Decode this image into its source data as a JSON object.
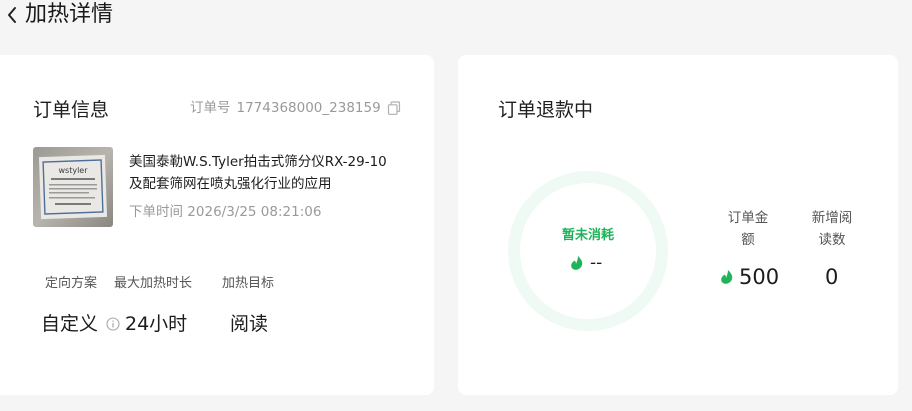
{
  "header": {
    "title": "加热详情"
  },
  "order_info": {
    "title": "订单信息",
    "order_no_label": "订单号",
    "order_no": "1774368000_238159",
    "product_title": "美国泰勒W.S.Tyler拍击式筛分仪RX-29-10及配套筛网在喷丸强化行业的应用",
    "order_time_label": "下单时间",
    "order_time": "2026/3/25 08:21:06",
    "thumb_text": "wstyler",
    "fields": [
      {
        "label": "定向方案",
        "value": "自定义"
      },
      {
        "label": "最大加热时长",
        "value": "24小时"
      },
      {
        "label": "加热目标",
        "value": "阅读"
      }
    ]
  },
  "refund": {
    "title": "订单退款中",
    "ring_label": "暂未消耗",
    "ring_value": "--",
    "stats": [
      {
        "label": "订单金额",
        "value": "500"
      },
      {
        "label": "新增阅读数",
        "value": "0"
      }
    ]
  },
  "colors": {
    "accent_green": "#1fb45a",
    "ring_track": "#eefaf3"
  },
  "icons": {
    "back": "chevron-left-icon",
    "copy": "copy-icon",
    "info": "info-icon",
    "coin": "leaf-coin-icon"
  }
}
